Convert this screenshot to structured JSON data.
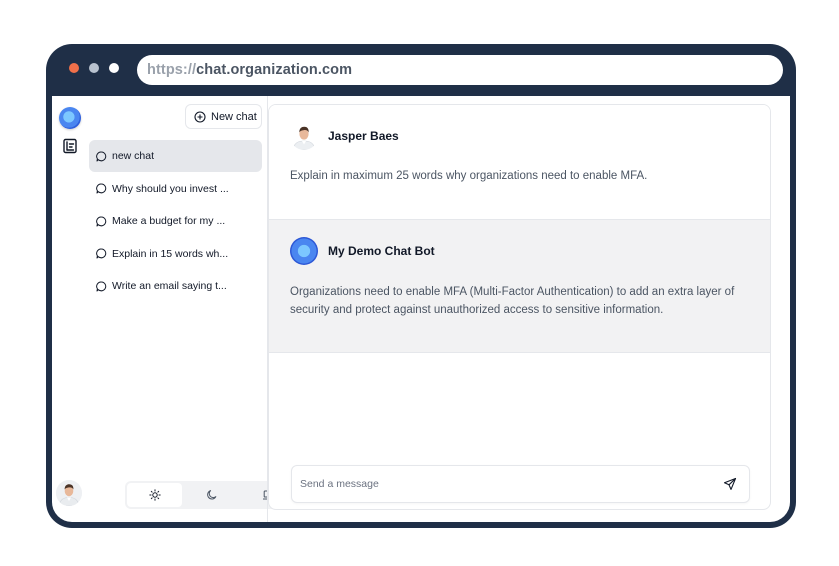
{
  "browser": {
    "url_protocol": "https://",
    "url_host": "chat.organization.com"
  },
  "sidebar": {
    "new_chat_label": "New chat",
    "chats": [
      {
        "label": "new chat",
        "active": true
      },
      {
        "label": "Why should you invest ...",
        "active": false
      },
      {
        "label": "Make a budget for my ...",
        "active": false
      },
      {
        "label": "Explain in 15 words wh...",
        "active": false
      },
      {
        "label": "Write an email saying t...",
        "active": false
      }
    ],
    "theme": {
      "options": [
        "sun-icon",
        "moon-icon",
        "laptop-icon"
      ],
      "selected": "sun-icon"
    }
  },
  "conversation": {
    "user_message": {
      "author": "Jasper Baes",
      "text": "Explain in maximum 25 words why organizations need to enable MFA."
    },
    "bot_message": {
      "author": "My Demo Chat Bot",
      "text": "Organizations need to enable MFA (Multi-Factor Authentication) to add an extra layer of security and protect against unauthorized access to sensitive information."
    }
  },
  "composer": {
    "placeholder": "Send a message",
    "value": ""
  },
  "colors": {
    "frame": "#1f2f47",
    "accent_orb": "#4a86f0",
    "active_item": "#e5e7eb",
    "bot_bg": "#f2f2f3"
  }
}
